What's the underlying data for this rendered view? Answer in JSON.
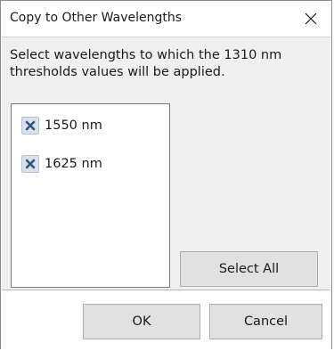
{
  "window": {
    "title": "Copy to Other Wavelengths",
    "close_icon": "close-icon"
  },
  "content": {
    "instructions_line1": "Select wavelengths to which the 1310 nm",
    "instructions_line2": "thresholds values will be applied."
  },
  "wavelengths": [
    {
      "label": "1550 nm",
      "icon": "x-remove-icon"
    },
    {
      "label": "1625 nm",
      "icon": "x-remove-icon"
    }
  ],
  "buttons": {
    "select_all": "Select All",
    "ok": "OK",
    "cancel": "Cancel"
  },
  "colors": {
    "panel_background": "#f0f0f0",
    "icon_background": "#d8e1ec",
    "icon_cross": "#33577a",
    "button_face": "#e1e1e1"
  }
}
